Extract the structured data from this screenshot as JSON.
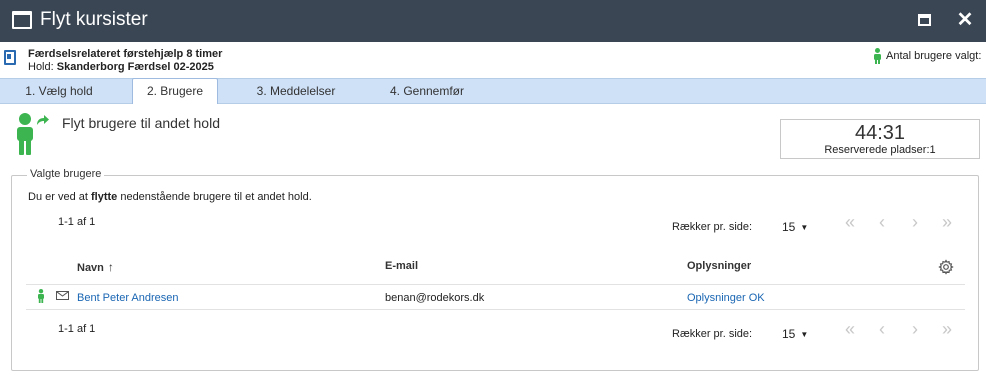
{
  "window": {
    "title": "Flyt kursister"
  },
  "course": {
    "name": "Færdselsrelateret førstehjælp 8 timer",
    "hold_label": "Hold:",
    "hold_value": "Skanderborg Færdsel 02-2025",
    "users_selected_label": "Antal brugere valgt:"
  },
  "tabs": [
    {
      "label": "1. Vælg hold",
      "active": false
    },
    {
      "label": "2. Brugere",
      "active": true
    },
    {
      "label": "3. Meddelelser",
      "active": false
    },
    {
      "label": "4. Gennemfør",
      "active": false
    }
  ],
  "main": {
    "heading": "Flyt brugere til andet hold"
  },
  "timer": {
    "value": "44:31",
    "label": "Reserverede pladser:1"
  },
  "section": {
    "legend": "Valgte brugere",
    "desc_prefix": "Du er ved at",
    "desc_bold": "flytte",
    "desc_suffix": "nedenstående brugere til et andet hold."
  },
  "pagination": {
    "range": "1-1 af 1",
    "rows_label": "Rækker pr. side:",
    "rows_value": "15",
    "first": "«",
    "prev": "‹",
    "next": "›",
    "last": "»"
  },
  "table": {
    "headers": {
      "name": "Navn",
      "email": "E-mail",
      "info": "Oplysninger"
    },
    "sort_indicator": "↑",
    "rows": [
      {
        "name": "Bent Peter Andresen",
        "email": "benan@rodekors.dk",
        "info": "Oplysninger OK"
      }
    ]
  },
  "icons": {
    "window": "window-icon",
    "maximize": "maximize-icon",
    "close": "close-icon",
    "book": "book-icon",
    "user": "user-icon",
    "arrow": "forward-arrow-icon",
    "mail": "mail-icon",
    "gear": "gear-icon"
  },
  "colors": {
    "titlebar": "#3a4654",
    "tabbar": "#cfe1f7",
    "user_green": "#3cb550",
    "link": "#1a66b3"
  }
}
